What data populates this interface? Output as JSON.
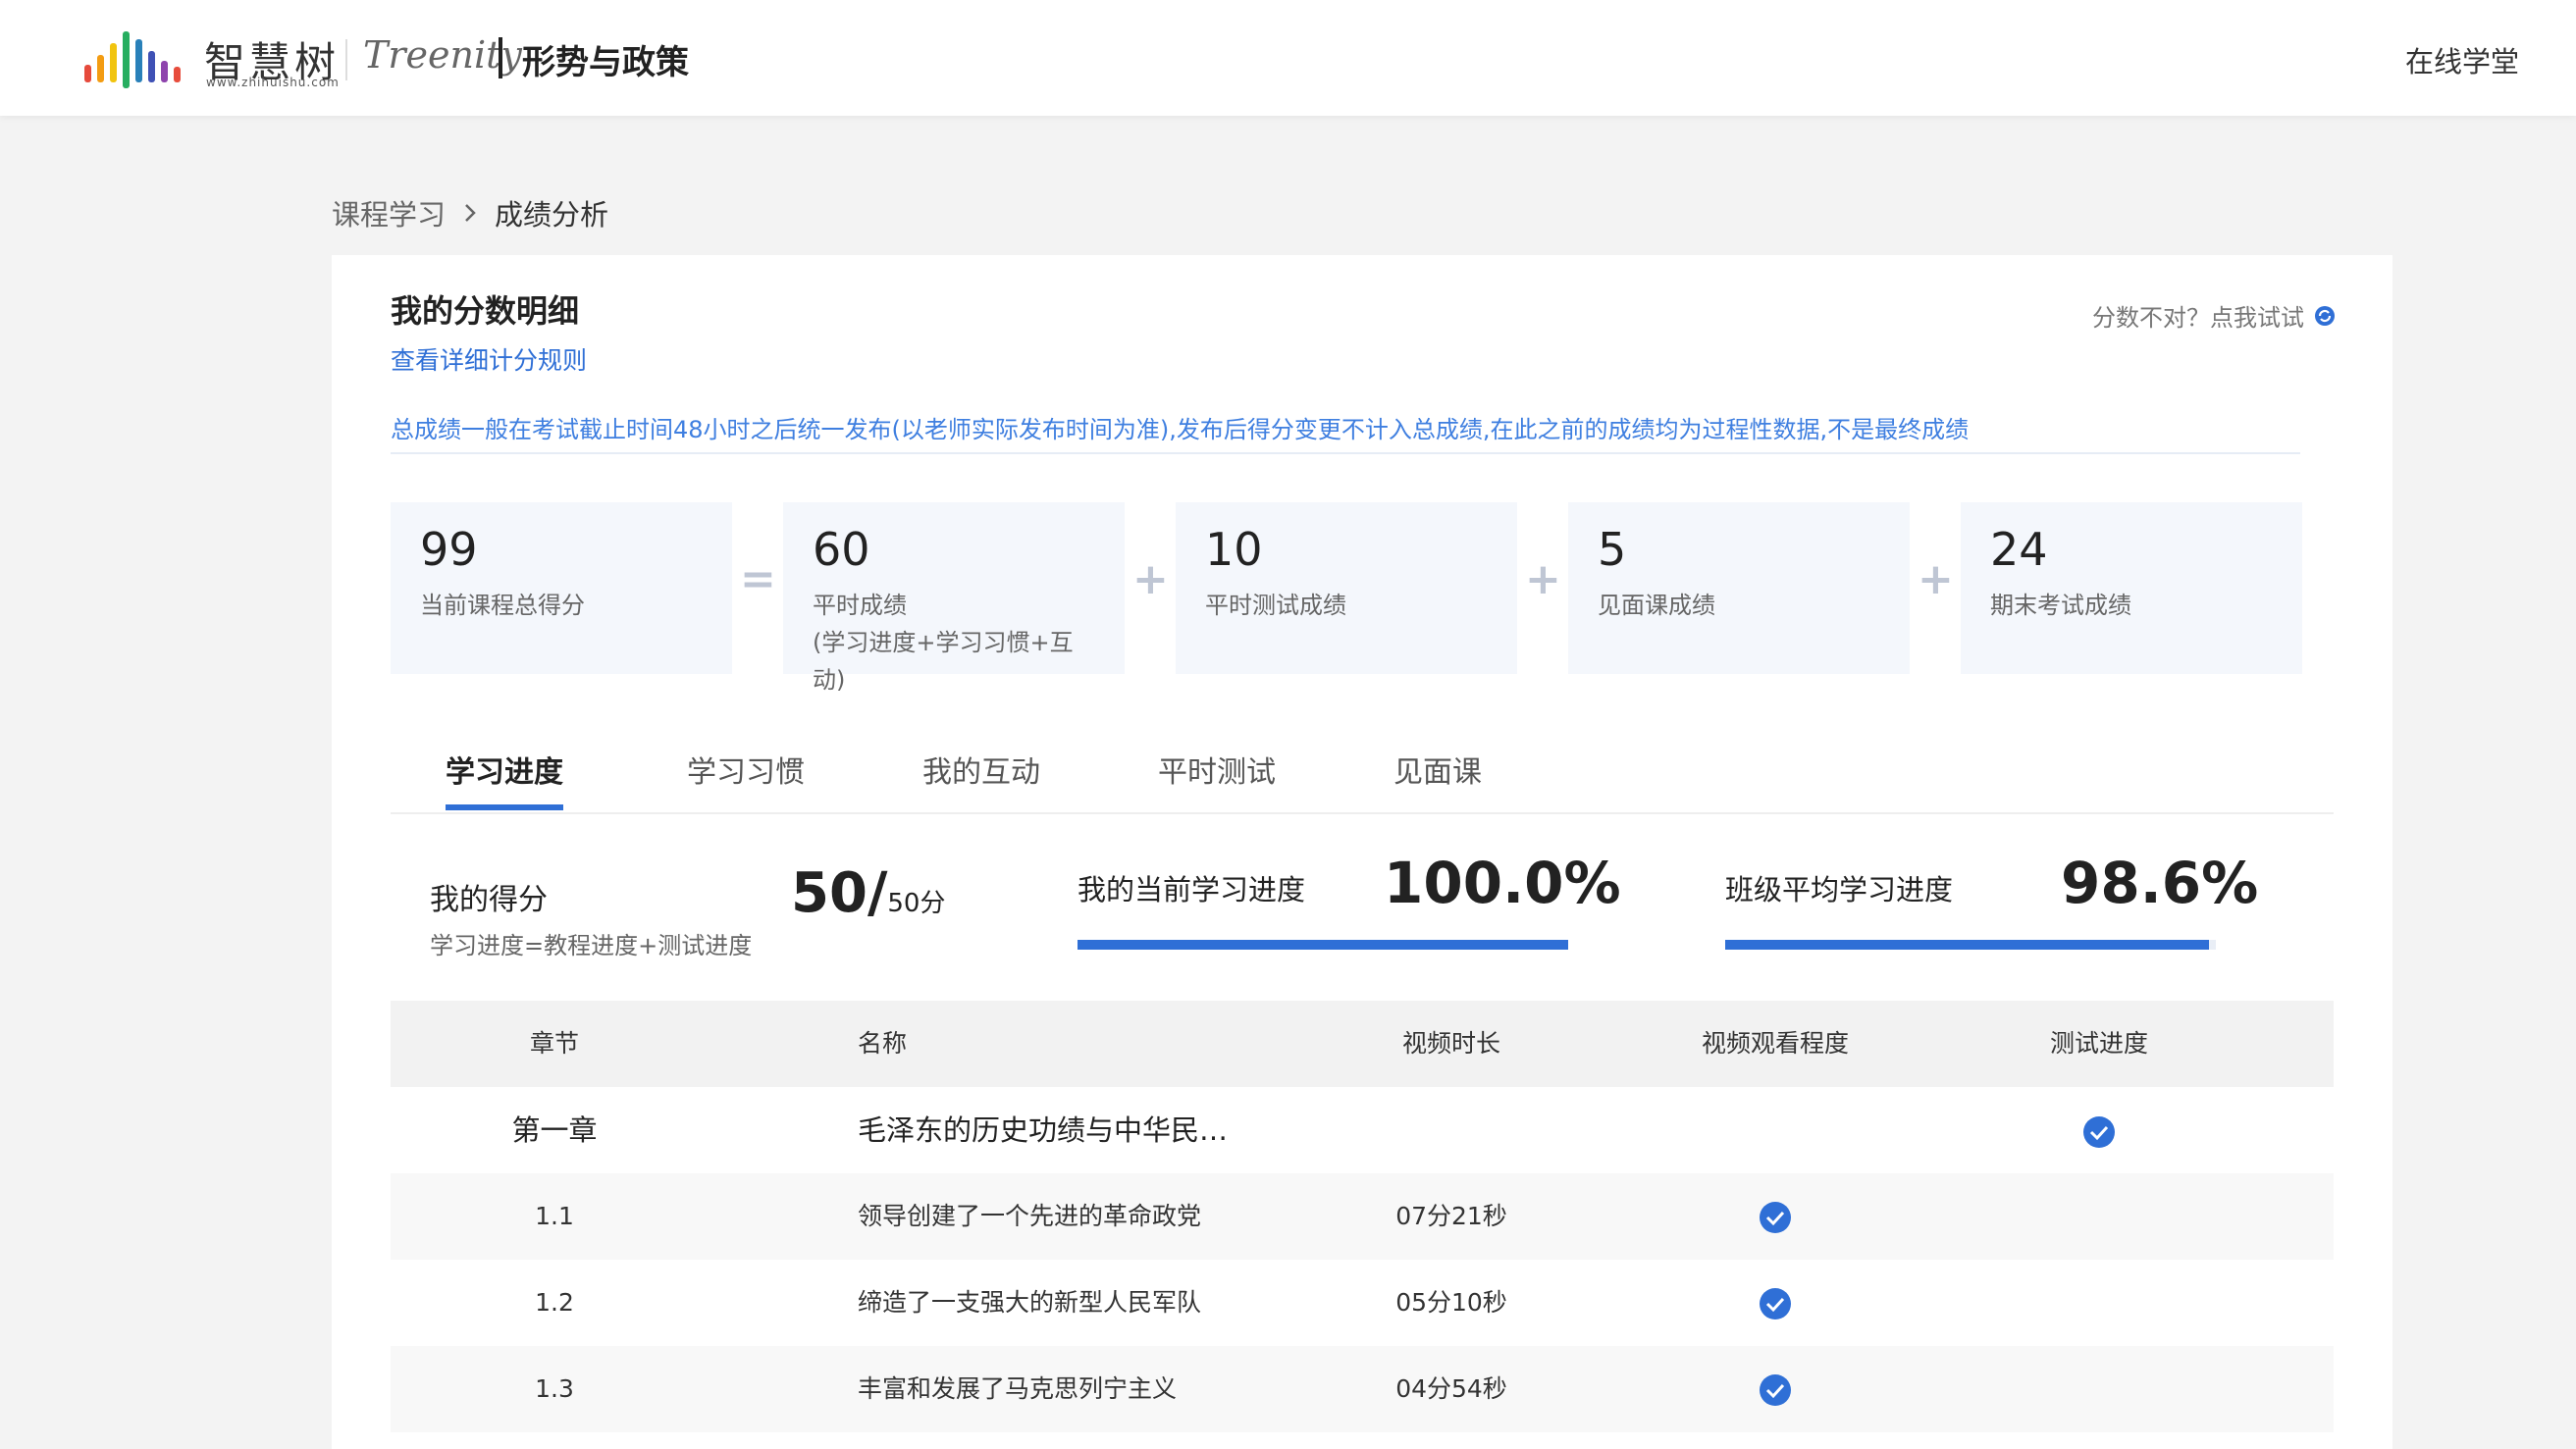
{
  "header": {
    "logo_cn": "智慧树",
    "logo_url_text": "www.zhihuishu.com",
    "logo_brand": "Treenity",
    "course_title": "形势与政策",
    "right_link": "在线学堂"
  },
  "breadcrumb": {
    "parent": "课程学习",
    "current": "成绩分析"
  },
  "card": {
    "title": "我的分数明细",
    "rule_link": "查看详细计分规则",
    "retry_text": "分数不对？点我试试",
    "notice": "总成绩一般在考试截止时间48小时之后统一发布(以老师实际发布时间为准),发布后得分变更不计入总成绩,在此之前的成绩均为过程性数据,不是最终成绩"
  },
  "scores": [
    {
      "value": "99",
      "label": "当前课程总得分",
      "sub": ""
    },
    {
      "value": "60",
      "label": "平时成绩",
      "sub": "(学习进度+学习习惯+互动)"
    },
    {
      "value": "10",
      "label": "平时测试成绩",
      "sub": ""
    },
    {
      "value": "5",
      "label": "见面课成绩",
      "sub": ""
    },
    {
      "value": "24",
      "label": "期末考试成绩",
      "sub": ""
    }
  ],
  "operators": [
    "=",
    "+",
    "+",
    "+"
  ],
  "tabs": [
    "学习进度",
    "学习习惯",
    "我的互动",
    "平时测试",
    "见面课"
  ],
  "progress": {
    "my_score_label": "我的得分",
    "my_score_formula": "学习进度=教程进度+测试进度",
    "my_score": "50",
    "my_score_total": "50分",
    "my_progress_label": "我的当前学习进度",
    "my_progress_text": "100.0%",
    "my_progress_fraction": 1.0,
    "class_progress_label": "班级平均学习进度",
    "class_progress_text": "98.6%",
    "class_progress_fraction": 0.986
  },
  "table": {
    "headers": [
      "章节",
      "名称",
      "视频时长",
      "视频观看程度",
      "测试进度"
    ],
    "rows": [
      {
        "chapter": "第一章",
        "name": "毛泽东的历史功绩与中华民…",
        "duration": "",
        "watched": false,
        "tested": true,
        "is_chapter": true
      },
      {
        "chapter": "1.1",
        "name": "领导创建了一个先进的革命政党",
        "duration": "07分21秒",
        "watched": true,
        "tested": false,
        "is_chapter": false
      },
      {
        "chapter": "1.2",
        "name": "缔造了一支强大的新型人民军队",
        "duration": "05分10秒",
        "watched": true,
        "tested": false,
        "is_chapter": false
      },
      {
        "chapter": "1.3",
        "name": "丰富和发展了马克思列宁主义",
        "duration": "04分54秒",
        "watched": true,
        "tested": false,
        "is_chapter": false
      }
    ]
  },
  "colors": {
    "accent": "#2f6fd6",
    "notice": "#3f7fe0",
    "score_bg": "#f4f7fc"
  }
}
